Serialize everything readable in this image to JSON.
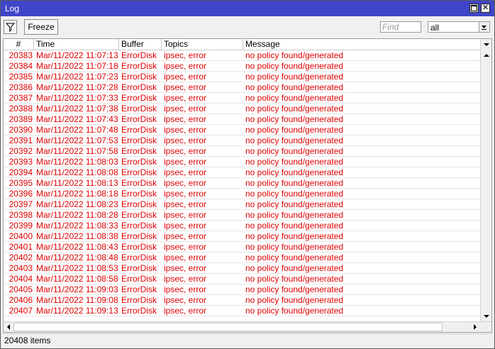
{
  "window": {
    "title": "Log"
  },
  "toolbar": {
    "freeze_label": "Freeze",
    "find_placeholder": "Find",
    "select_value": "all"
  },
  "columns": {
    "num": "#",
    "time": "Time",
    "buffer": "Buffer",
    "topics": "Topics",
    "message": "Message"
  },
  "colors": {
    "titlebar": "#3f46c8",
    "error_text": "#e00000"
  },
  "rows": [
    {
      "num": "20383",
      "time": "Mar/11/2022 11:07:13",
      "buffer": "ErrorDisk",
      "topics": "ipsec, error",
      "message": "no policy found/generated"
    },
    {
      "num": "20384",
      "time": "Mar/11/2022 11:07:18",
      "buffer": "ErrorDisk",
      "topics": "ipsec, error",
      "message": "no policy found/generated"
    },
    {
      "num": "20385",
      "time": "Mar/11/2022 11:07:23",
      "buffer": "ErrorDisk",
      "topics": "ipsec, error",
      "message": "no policy found/generated"
    },
    {
      "num": "20386",
      "time": "Mar/11/2022 11:07:28",
      "buffer": "ErrorDisk",
      "topics": "ipsec, error",
      "message": "no policy found/generated"
    },
    {
      "num": "20387",
      "time": "Mar/11/2022 11:07:33",
      "buffer": "ErrorDisk",
      "topics": "ipsec, error",
      "message": "no policy found/generated"
    },
    {
      "num": "20388",
      "time": "Mar/11/2022 11:07:38",
      "buffer": "ErrorDisk",
      "topics": "ipsec, error",
      "message": "no policy found/generated"
    },
    {
      "num": "20389",
      "time": "Mar/11/2022 11:07:43",
      "buffer": "ErrorDisk",
      "topics": "ipsec, error",
      "message": "no policy found/generated"
    },
    {
      "num": "20390",
      "time": "Mar/11/2022 11:07:48",
      "buffer": "ErrorDisk",
      "topics": "ipsec, error",
      "message": "no policy found/generated"
    },
    {
      "num": "20391",
      "time": "Mar/11/2022 11:07:53",
      "buffer": "ErrorDisk",
      "topics": "ipsec, error",
      "message": "no policy found/generated"
    },
    {
      "num": "20392",
      "time": "Mar/11/2022 11:07:58",
      "buffer": "ErrorDisk",
      "topics": "ipsec, error",
      "message": "no policy found/generated"
    },
    {
      "num": "20393",
      "time": "Mar/11/2022 11:08:03",
      "buffer": "ErrorDisk",
      "topics": "ipsec, error",
      "message": "no policy found/generated"
    },
    {
      "num": "20394",
      "time": "Mar/11/2022 11:08:08",
      "buffer": "ErrorDisk",
      "topics": "ipsec, error",
      "message": "no policy found/generated"
    },
    {
      "num": "20395",
      "time": "Mar/11/2022 11:08:13",
      "buffer": "ErrorDisk",
      "topics": "ipsec, error",
      "message": "no policy found/generated"
    },
    {
      "num": "20396",
      "time": "Mar/11/2022 11:08:18",
      "buffer": "ErrorDisk",
      "topics": "ipsec, error",
      "message": "no policy found/generated"
    },
    {
      "num": "20397",
      "time": "Mar/11/2022 11:08:23",
      "buffer": "ErrorDisk",
      "topics": "ipsec, error",
      "message": "no policy found/generated"
    },
    {
      "num": "20398",
      "time": "Mar/11/2022 11:08:28",
      "buffer": "ErrorDisk",
      "topics": "ipsec, error",
      "message": "no policy found/generated"
    },
    {
      "num": "20399",
      "time": "Mar/11/2022 11:08:33",
      "buffer": "ErrorDisk",
      "topics": "ipsec, error",
      "message": "no policy found/generated"
    },
    {
      "num": "20400",
      "time": "Mar/11/2022 11:08:38",
      "buffer": "ErrorDisk",
      "topics": "ipsec, error",
      "message": "no policy found/generated"
    },
    {
      "num": "20401",
      "time": "Mar/11/2022 11:08:43",
      "buffer": "ErrorDisk",
      "topics": "ipsec, error",
      "message": "no policy found/generated"
    },
    {
      "num": "20402",
      "time": "Mar/11/2022 11:08:48",
      "buffer": "ErrorDisk",
      "topics": "ipsec, error",
      "message": "no policy found/generated"
    },
    {
      "num": "20403",
      "time": "Mar/11/2022 11:08:53",
      "buffer": "ErrorDisk",
      "topics": "ipsec, error",
      "message": "no policy found/generated"
    },
    {
      "num": "20404",
      "time": "Mar/11/2022 11:08:58",
      "buffer": "ErrorDisk",
      "topics": "ipsec, error",
      "message": "no policy found/generated"
    },
    {
      "num": "20405",
      "time": "Mar/11/2022 11:09:03",
      "buffer": "ErrorDisk",
      "topics": "ipsec, error",
      "message": "no policy found/generated"
    },
    {
      "num": "20406",
      "time": "Mar/11/2022 11:09:08",
      "buffer": "ErrorDisk",
      "topics": "ipsec, error",
      "message": "no policy found/generated"
    },
    {
      "num": "20407",
      "time": "Mar/11/2022 11:09:13",
      "buffer": "ErrorDisk",
      "topics": "ipsec, error",
      "message": "no policy found/generated"
    }
  ],
  "status": {
    "items_count": "20408 items"
  }
}
